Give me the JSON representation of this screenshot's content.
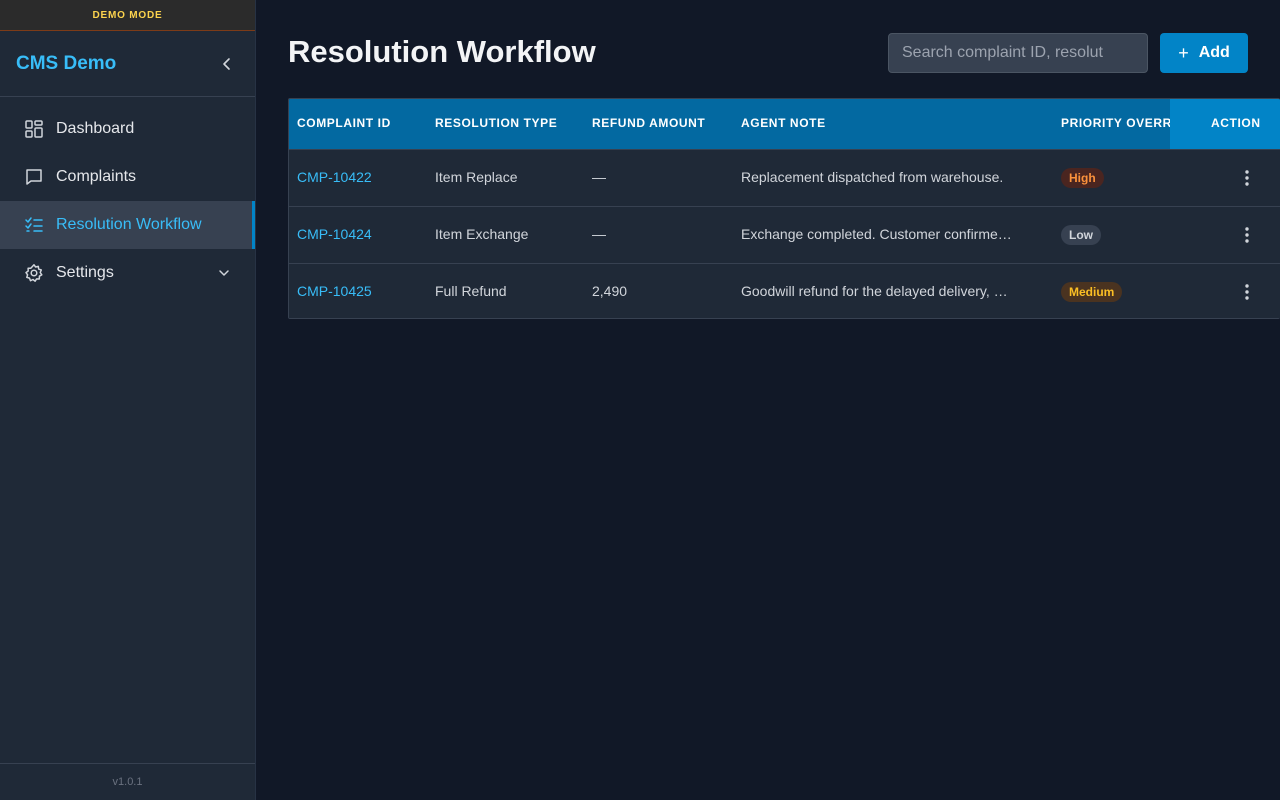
{
  "banner": {
    "text": "DEMO MODE"
  },
  "sidebar": {
    "brand": "CMS Demo",
    "items": [
      {
        "label": "Dashboard",
        "icon": "dashboard-icon"
      },
      {
        "label": "Complaints",
        "icon": "chat-icon"
      },
      {
        "label": "Resolution Workflow",
        "icon": "checklist-icon",
        "active": true
      },
      {
        "label": "Settings",
        "icon": "gear-icon",
        "expandable": true
      }
    ],
    "version": "v1.0.1"
  },
  "header": {
    "title": "Resolution Workflow",
    "search_placeholder": "Search complaint ID, resolut",
    "add_label": "Add"
  },
  "table": {
    "columns": [
      "COMPLAINT ID",
      "RESOLUTION TYPE",
      "REFUND AMOUNT",
      "AGENT NOTE",
      "PRIORITY OVERR",
      "ACTION"
    ],
    "rows": [
      {
        "id": "CMP-10422",
        "type": "Item Replace",
        "refund": "—",
        "note": "Replacement dispatched from warehouse.",
        "priority": "High"
      },
      {
        "id": "CMP-10424",
        "type": "Item Exchange",
        "refund": "—",
        "note": "Exchange completed. Customer confirme…",
        "priority": "Low"
      },
      {
        "id": "CMP-10425",
        "type": "Full Refund",
        "refund": "2,490",
        "note": "Goodwill refund for the delayed delivery, …",
        "priority": "Medium"
      }
    ]
  },
  "colors": {
    "accent": "#38bdf8",
    "primary": "#0284c7",
    "header_bg": "#0369a1",
    "background": "#111827",
    "sidebar_bg": "#1f2937"
  }
}
